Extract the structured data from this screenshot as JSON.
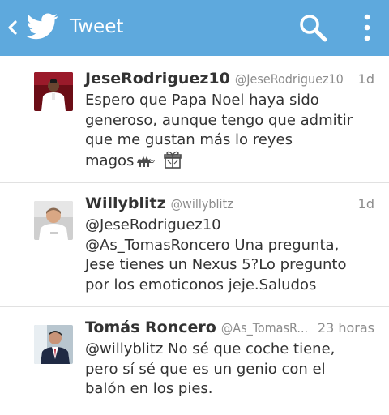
{
  "appbar": {
    "title": "Tweet",
    "back_icon": "chevron-left-icon",
    "logo_icon": "twitter-bird-icon",
    "search_icon": "search-icon",
    "menu_icon": "more-vertical-icon",
    "color": "#5ea9dd"
  },
  "tweets": [
    {
      "name": "JeseRodriguez10",
      "handle": "@JeseRodriguez10",
      "time": "1d",
      "lines": [
        "Espero que Papa Noel haya sido",
        "generoso, aunque tengo que admitir",
        "que me gustan más lo reyes",
        "magos"
      ],
      "emojis": [
        "camel-icon",
        "gift-icon"
      ]
    },
    {
      "name": "Willyblitz",
      "handle": "@willyblitz",
      "time": "1d",
      "lines": [
        "@JeseRodriguez10",
        "@As_TomasRoncero Una pregunta,",
        "Jese tienes un Nexus 5?Lo pregunto",
        "por los emoticonos jeje.Saludos"
      ]
    },
    {
      "name": "Tomás Roncero",
      "handle": "@As_TomasR...",
      "time": "23 horas",
      "lines": [
        "@willyblitz No sé que coche tiene,",
        "pero sí sé que es un genio con el",
        "balón en los pies."
      ]
    }
  ]
}
